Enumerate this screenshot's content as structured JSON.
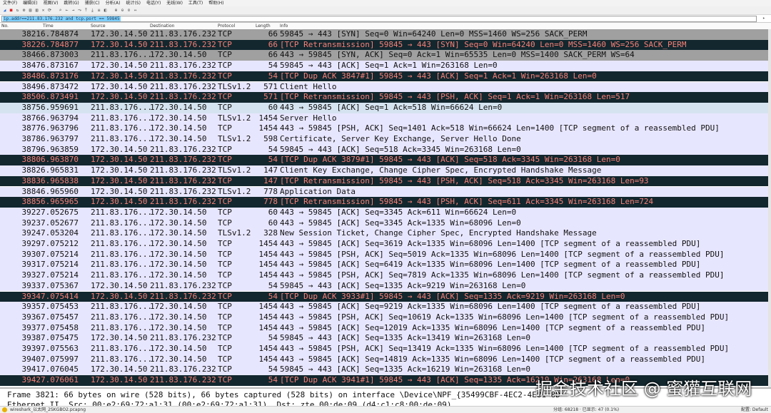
{
  "menu": [
    "文件(F)",
    "编辑(E)",
    "视图(V)",
    "跳转(G)",
    "捕获(C)",
    "分析(A)",
    "统计(S)",
    "电话(Y)",
    "无线(W)",
    "工具(T)",
    "帮助(H)"
  ],
  "toolbar_icons": [
    "shark-fin-icon",
    "stop-icon",
    "restart-icon",
    "options-icon",
    "open-icon",
    "save-icon",
    "close-icon",
    "reload-icon",
    "search-icon",
    "back-icon",
    "forward-icon",
    "jump-icon",
    "first-icon",
    "last-icon",
    "autoscroll-icon",
    "colorize-icon",
    "zoom-in-icon",
    "zoom-out-icon",
    "normal-size-icon",
    "resize-columns-icon"
  ],
  "filter": {
    "value": "ip.addr==211.83.176.232 and tcp.port == 59845"
  },
  "columns": {
    "no": "No.",
    "time": "Time",
    "src": "Source",
    "dst": "Destination",
    "proto": "Protocol",
    "len": "Length",
    "info": "Info"
  },
  "packets": [
    {
      "no": "3821",
      "time": "6.784874",
      "src": "172.30.14.50",
      "dst": "211.83.176.232",
      "proto": "TCP",
      "len": "66",
      "info": "59845 → 443 [SYN] Seq=0 Win=64240 Len=0 MSS=1460 WS=256 SACK_PERM",
      "type": "syn"
    },
    {
      "no": "3822",
      "time": "6.784877",
      "src": "172.30.14.50",
      "dst": "211.83.176.232",
      "proto": "TCP",
      "len": "66",
      "info": "[TCP Retransmission] 59845 → 443 [SYN] Seq=0 Win=64240 Len=0 MSS=1460 WS=256 SACK_PERM",
      "type": "bad"
    },
    {
      "no": "3846",
      "time": "6.873003",
      "src": "211.83.176...",
      "dst": "172.30.14.50",
      "proto": "TCP",
      "len": "66",
      "info": "443 → 59845 [SYN, ACK] Seq=0 Ack=1 Win=65535 Len=0 MSS=1400 SACK_PERM WS=64",
      "type": "syn"
    },
    {
      "no": "3847",
      "time": "6.873167",
      "src": "172.30.14.50",
      "dst": "211.83.176.232",
      "proto": "TCP",
      "len": "54",
      "info": "59845 → 443 [ACK] Seq=1 Ack=1 Win=263168 Len=0",
      "type": "tcp"
    },
    {
      "no": "3848",
      "time": "6.873176",
      "src": "172.30.14.50",
      "dst": "211.83.176.232",
      "proto": "TCP",
      "len": "54",
      "info": "[TCP Dup ACK 3847#1] 59845 → 443 [ACK] Seq=1 Ack=1 Win=263168 Len=0",
      "type": "bad"
    },
    {
      "no": "3849",
      "time": "6.873472",
      "src": "172.30.14.50",
      "dst": "211.83.176.232",
      "proto": "TLSv1.2",
      "len": "571",
      "info": "Client Hello",
      "type": "tls"
    },
    {
      "no": "3850",
      "time": "6.873491",
      "src": "172.30.14.50",
      "dst": "211.83.176.232",
      "proto": "TCP",
      "len": "571",
      "info": "[TCP Retransmission] 59845 → 443 [PSH, ACK] Seq=1 Ack=1 Win=263168 Len=517",
      "type": "bad"
    },
    {
      "no": "3875",
      "time": "6.959691",
      "src": "211.83.176...",
      "dst": "172.30.14.50",
      "proto": "TCP",
      "len": "60",
      "info": "443 → 59845 [ACK] Seq=1 Ack=518 Win=66624 Len=0",
      "type": "sel"
    },
    {
      "no": "3876",
      "time": "6.963794",
      "src": "211.83.176...",
      "dst": "172.30.14.50",
      "proto": "TLSv1.2",
      "len": "1454",
      "info": "Server Hello",
      "type": "tls"
    },
    {
      "no": "3877",
      "time": "6.963796",
      "src": "211.83.176...",
      "dst": "172.30.14.50",
      "proto": "TCP",
      "len": "1454",
      "info": "443 → 59845 [PSH, ACK] Seq=1401 Ack=518 Win=66624 Len=1400 [TCP segment of a reassembled PDU]",
      "type": "tcp"
    },
    {
      "no": "3878",
      "time": "6.963797",
      "src": "211.83.176...",
      "dst": "172.30.14.50",
      "proto": "TLSv1.2",
      "len": "598",
      "info": "Certificate, Server Key Exchange, Server Hello Done",
      "type": "tls"
    },
    {
      "no": "3879",
      "time": "6.963859",
      "src": "172.30.14.50",
      "dst": "211.83.176.232",
      "proto": "TCP",
      "len": "54",
      "info": "59845 → 443 [ACK] Seq=518 Ack=3345 Win=263168 Len=0",
      "type": "tcp"
    },
    {
      "no": "3880",
      "time": "6.963870",
      "src": "172.30.14.50",
      "dst": "211.83.176.232",
      "proto": "TCP",
      "len": "54",
      "info": "[TCP Dup ACK 3879#1] 59845 → 443 [ACK] Seq=518 Ack=3345 Win=263168 Len=0",
      "type": "bad"
    },
    {
      "no": "3882",
      "time": "6.965831",
      "src": "172.30.14.50",
      "dst": "211.83.176.232",
      "proto": "TLSv1.2",
      "len": "147",
      "info": "Client Key Exchange, Change Cipher Spec, Encrypted Handshake Message",
      "type": "tls"
    },
    {
      "no": "3883",
      "time": "6.965838",
      "src": "172.30.14.50",
      "dst": "211.83.176.232",
      "proto": "TCP",
      "len": "147",
      "info": "[TCP Retransmission] 59845 → 443 [PSH, ACK] Seq=518 Ack=3345 Win=263168 Len=93",
      "type": "bad"
    },
    {
      "no": "3884",
      "time": "6.965960",
      "src": "172.30.14.50",
      "dst": "211.83.176.232",
      "proto": "TLSv1.2",
      "len": "778",
      "info": "Application Data",
      "type": "tls"
    },
    {
      "no": "3885",
      "time": "6.965965",
      "src": "172.30.14.50",
      "dst": "211.83.176.232",
      "proto": "TCP",
      "len": "778",
      "info": "[TCP Retransmission] 59845 → 443 [PSH, ACK] Seq=611 Ack=3345 Win=263168 Len=724",
      "type": "bad"
    },
    {
      "no": "3922",
      "time": "7.052675",
      "src": "211.83.176...",
      "dst": "172.30.14.50",
      "proto": "TCP",
      "len": "60",
      "info": "443 → 59845 [ACK] Seq=3345 Ack=611 Win=66624 Len=0",
      "type": "tcp"
    },
    {
      "no": "3923",
      "time": "7.052677",
      "src": "211.83.176...",
      "dst": "172.30.14.50",
      "proto": "TCP",
      "len": "60",
      "info": "443 → 59845 [ACK] Seq=3345 Ack=1335 Win=68096 Len=0",
      "type": "tcp"
    },
    {
      "no": "3924",
      "time": "7.053204",
      "src": "211.83.176...",
      "dst": "172.30.14.50",
      "proto": "TLSv1.2",
      "len": "328",
      "info": "New Session Ticket, Change Cipher Spec, Encrypted Handshake Message",
      "type": "tls"
    },
    {
      "no": "3929",
      "time": "7.075212",
      "src": "211.83.176...",
      "dst": "172.30.14.50",
      "proto": "TCP",
      "len": "1454",
      "info": "443 → 59845 [ACK] Seq=3619 Ack=1335 Win=68096 Len=1400 [TCP segment of a reassembled PDU]",
      "type": "tcp"
    },
    {
      "no": "3930",
      "time": "7.075214",
      "src": "211.83.176...",
      "dst": "172.30.14.50",
      "proto": "TCP",
      "len": "1454",
      "info": "443 → 59845 [PSH, ACK] Seq=5019 Ack=1335 Win=68096 Len=1400 [TCP segment of a reassembled PDU]",
      "type": "tcp"
    },
    {
      "no": "3931",
      "time": "7.075214",
      "src": "211.83.176...",
      "dst": "172.30.14.50",
      "proto": "TCP",
      "len": "1454",
      "info": "443 → 59845 [ACK] Seq=6419 Ack=1335 Win=68096 Len=1400 [TCP segment of a reassembled PDU]",
      "type": "tcp"
    },
    {
      "no": "3932",
      "time": "7.075214",
      "src": "211.83.176...",
      "dst": "172.30.14.50",
      "proto": "TCP",
      "len": "1454",
      "info": "443 → 59845 [PSH, ACK] Seq=7819 Ack=1335 Win=68096 Len=1400 [TCP segment of a reassembled PDU]",
      "type": "tcp"
    },
    {
      "no": "3933",
      "time": "7.075367",
      "src": "172.30.14.50",
      "dst": "211.83.176.232",
      "proto": "TCP",
      "len": "54",
      "info": "59845 → 443 [ACK] Seq=1335 Ack=9219 Win=263168 Len=0",
      "type": "tcp"
    },
    {
      "no": "3934",
      "time": "7.075414",
      "src": "172.30.14.50",
      "dst": "211.83.176.232",
      "proto": "TCP",
      "len": "54",
      "info": "[TCP Dup ACK 3933#1] 59845 → 443 [ACK] Seq=1335 Ack=9219 Win=263168 Len=0",
      "type": "bad"
    },
    {
      "no": "3935",
      "time": "7.075453",
      "src": "211.83.176...",
      "dst": "172.30.14.50",
      "proto": "TCP",
      "len": "1454",
      "info": "443 → 59845 [ACK] Seq=9219 Ack=1335 Win=68096 Len=1400 [TCP segment of a reassembled PDU]",
      "type": "tcp"
    },
    {
      "no": "3936",
      "time": "7.075457",
      "src": "211.83.176...",
      "dst": "172.30.14.50",
      "proto": "TCP",
      "len": "1454",
      "info": "443 → 59845 [PSH, ACK] Seq=10619 Ack=1335 Win=68096 Len=1400 [TCP segment of a reassembled PDU]",
      "type": "tcp"
    },
    {
      "no": "3937",
      "time": "7.075458",
      "src": "211.83.176...",
      "dst": "172.30.14.50",
      "proto": "TCP",
      "len": "1454",
      "info": "443 → 59845 [ACK] Seq=12019 Ack=1335 Win=68096 Len=1400 [TCP segment of a reassembled PDU]",
      "type": "tcp"
    },
    {
      "no": "3938",
      "time": "7.075475",
      "src": "172.30.14.50",
      "dst": "211.83.176.232",
      "proto": "TCP",
      "len": "54",
      "info": "59845 → 443 [ACK] Seq=1335 Ack=13419 Win=263168 Len=0",
      "type": "tcp"
    },
    {
      "no": "3939",
      "time": "7.075563",
      "src": "211.83.176...",
      "dst": "172.30.14.50",
      "proto": "TCP",
      "len": "1454",
      "info": "443 → 59845 [PSH, ACK] Seq=13419 Ack=1335 Win=68096 Len=1400 [TCP segment of a reassembled PDU]",
      "type": "tcp"
    },
    {
      "no": "3940",
      "time": "7.075997",
      "src": "211.83.176...",
      "dst": "172.30.14.50",
      "proto": "TCP",
      "len": "1454",
      "info": "443 → 59845 [ACK] Seq=14819 Ack=1335 Win=68096 Len=1400 [TCP segment of a reassembled PDU]",
      "type": "tcp"
    },
    {
      "no": "3941",
      "time": "7.076045",
      "src": "172.30.14.50",
      "dst": "211.83.176.232",
      "proto": "TCP",
      "len": "54",
      "info": "59845 → 443 [ACK] Seq=1335 Ack=16219 Win=263168 Len=0",
      "type": "tcp"
    },
    {
      "no": "3942",
      "time": "7.076061",
      "src": "172.30.14.50",
      "dst": "211.83.176.232",
      "proto": "TCP",
      "len": "54",
      "info": "[TCP Dup ACK 3941#1] 59845 → 443 [ACK] Seq=1335 Ack=16219 Win=263168 Len=0",
      "type": "bad"
    }
  ],
  "detail": {
    "line1": "Frame 3821: 66 bytes on wire (528 bits), 66 bytes captured (528 bits) on interface \\Device\\NPF_{35499CBF-4EC2-4E81-8D",
    "line2": "Ethernet II, Src: 00:e2:69:72:a1:31 (00:e2:69:72:a1:31), Dst: zte_00:de:09 (d4:c1:c8:00:de:09)"
  },
  "watermark": "掘金技术社区 @ 蜜獾互联网",
  "status": {
    "file": "wireshark_以太网_2SKGBO2.pcapng",
    "packets": "分组: 68218 · 已显示: 47 (0.1%)",
    "profile": "配置: Default"
  },
  "colors": {
    "syn_bg": "#a0a0a0",
    "bad_bg": "#12272e",
    "bad_fg": "#f78077",
    "tcp_bg": "#e7e6ff",
    "selected_bg": "#d5e3f0",
    "filter_highlight": "#7fd0ff"
  }
}
